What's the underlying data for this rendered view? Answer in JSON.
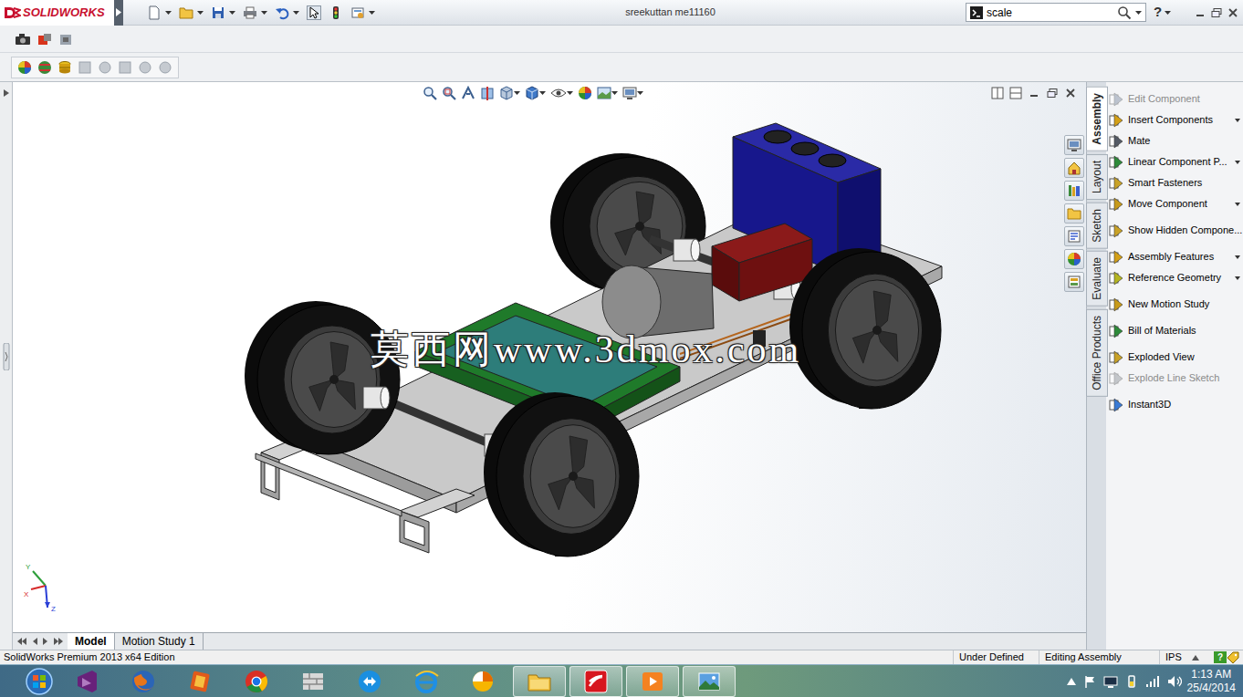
{
  "app": {
    "logo": "SOLIDWORKS"
  },
  "window": {
    "title": "sreekuttan me11160"
  },
  "search": {
    "value": "scale"
  },
  "help": "?",
  "command_tabs": [
    {
      "label": "Assembly",
      "selected": true
    },
    {
      "label": "Layout",
      "selected": false
    },
    {
      "label": "Sketch",
      "selected": false
    },
    {
      "label": "Evaluate",
      "selected": false
    },
    {
      "label": "Office Products",
      "selected": false
    }
  ],
  "commands": [
    [
      {
        "label": "Edit Component",
        "disabled": true,
        "dropdown": false
      },
      {
        "label": "Insert Components",
        "disabled": false,
        "dropdown": true
      },
      {
        "label": "Mate",
        "disabled": false,
        "dropdown": false
      },
      {
        "label": "Linear Component P...",
        "disabled": false,
        "dropdown": true
      },
      {
        "label": "Smart Fasteners",
        "disabled": false,
        "dropdown": false
      },
      {
        "label": "Move Component",
        "disabled": false,
        "dropdown": true
      }
    ],
    [
      {
        "label": "Show Hidden Compone...",
        "disabled": false,
        "dropdown": false
      }
    ],
    [
      {
        "label": "Assembly Features",
        "disabled": false,
        "dropdown": true
      },
      {
        "label": "Reference Geometry",
        "disabled": false,
        "dropdown": true
      }
    ],
    [
      {
        "label": "New Motion Study",
        "disabled": false,
        "dropdown": false
      }
    ],
    [
      {
        "label": "Bill of Materials",
        "disabled": false,
        "dropdown": false
      }
    ],
    [
      {
        "label": "Exploded View",
        "disabled": false,
        "dropdown": false
      },
      {
        "label": "Explode Line Sketch",
        "disabled": true,
        "dropdown": false
      }
    ],
    [
      {
        "label": "Instant3D",
        "disabled": false,
        "dropdown": false
      }
    ]
  ],
  "viewport": {
    "watermark": "莫西网www.3dmox.com",
    "triad": [
      "Y",
      "X",
      "Z"
    ]
  },
  "bottom_tabs": [
    {
      "label": "Model",
      "selected": true
    },
    {
      "label": "Motion Study 1",
      "selected": false
    }
  ],
  "status_bar": {
    "edition": "SolidWorks Premium 2013 x64 Edition",
    "state": "Under Defined",
    "mode": "Editing Assembly",
    "units": "IPS",
    "help": "?"
  },
  "taskbar": {
    "apps": [
      {
        "running": false
      },
      {
        "running": false
      },
      {
        "running": false
      },
      {
        "running": false
      },
      {
        "running": false
      },
      {
        "running": false
      },
      {
        "running": false
      },
      {
        "running": false
      },
      {
        "running": true
      },
      {
        "running": true
      },
      {
        "running": true
      },
      {
        "running": true
      }
    ],
    "time": "1:13 AM",
    "date": "25/4/2014"
  }
}
